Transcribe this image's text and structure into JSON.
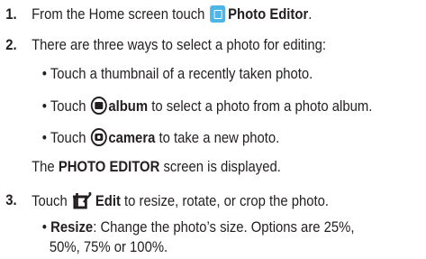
{
  "steps": [
    {
      "num": "1.",
      "pre": "From the Home screen touch ",
      "icon": "photo-editor-app-icon",
      "bold": "Photo Editor",
      "post": "."
    },
    {
      "num": "2.",
      "text": "There are three ways to select a photo for editing:",
      "bullets": [
        {
          "pre": "Touch a thumbnail of a recently taken photo."
        },
        {
          "pre": "Touch ",
          "icon": "album-icon",
          "bold": "album",
          "post": " to select a photo from a photo album."
        },
        {
          "pre": "Touch ",
          "icon": "camera-icon",
          "bold": "camera",
          "post": " to take a new photo."
        }
      ],
      "after_pre": "The ",
      "after_bold": "PHOTO EDITOR",
      "after_post": " screen is displayed."
    },
    {
      "num": "3.",
      "pre": "Touch ",
      "icon": "edit-icon",
      "bold": "Edit",
      "post": " to resize, rotate, or crop the photo.",
      "bullets": [
        {
          "bold": "Resize",
          "line1": ": Change the photo’s size. Options are 25%,",
          "line2": "50%, 75% or 100%."
        }
      ]
    }
  ],
  "bullet_char": "•"
}
